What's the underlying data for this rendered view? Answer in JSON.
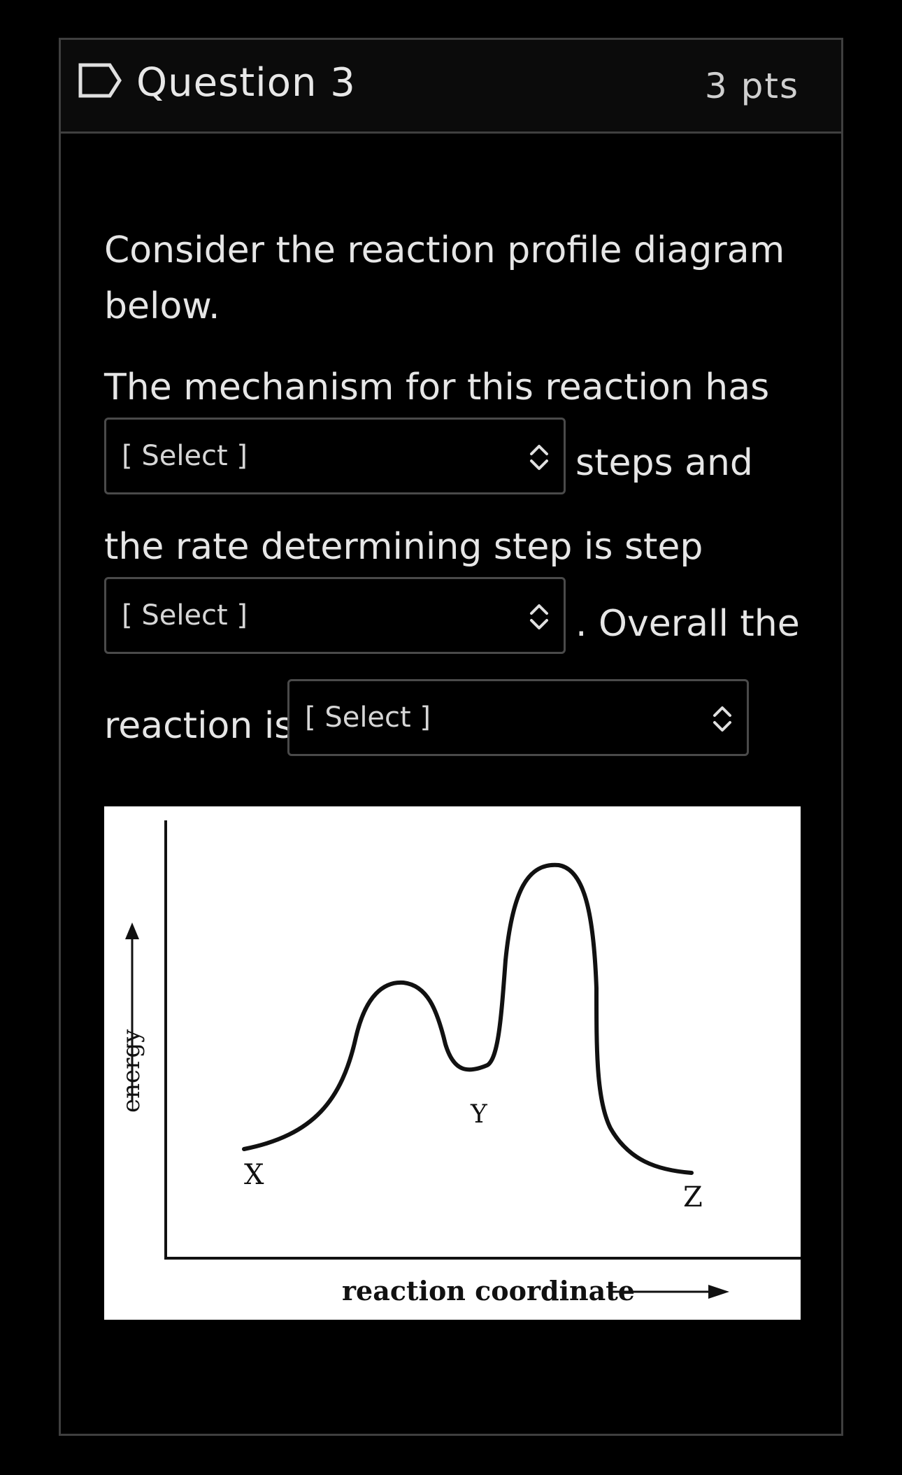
{
  "question": {
    "title": "Question 3",
    "points": "3 pts"
  },
  "prompt": {
    "line1": "Consider the reaction profile diagram",
    "line2": "below.",
    "line3": "The mechanism for this reaction has",
    "after_select1": "steps and",
    "line4": "the rate determining step is step",
    "after_select2": ".  Overall the",
    "before_select3": "reaction is"
  },
  "selects": [
    {
      "value": "[ Select ]"
    },
    {
      "value": "[ Select ]"
    },
    {
      "value": "[ Select ]"
    }
  ],
  "diagram": {
    "y_axis_label": "energy",
    "x_axis_label": "reaction coordinate",
    "points": {
      "x": "X",
      "y": "Y",
      "z": "Z"
    }
  },
  "icons": {
    "flag": "flag-outline-icon",
    "select_arrows": "updown-chevron-icon"
  },
  "colors": {
    "background": "#000000",
    "header": "#0b0b0b",
    "border": "#3f3f3f",
    "text": "#e6e6e6"
  }
}
